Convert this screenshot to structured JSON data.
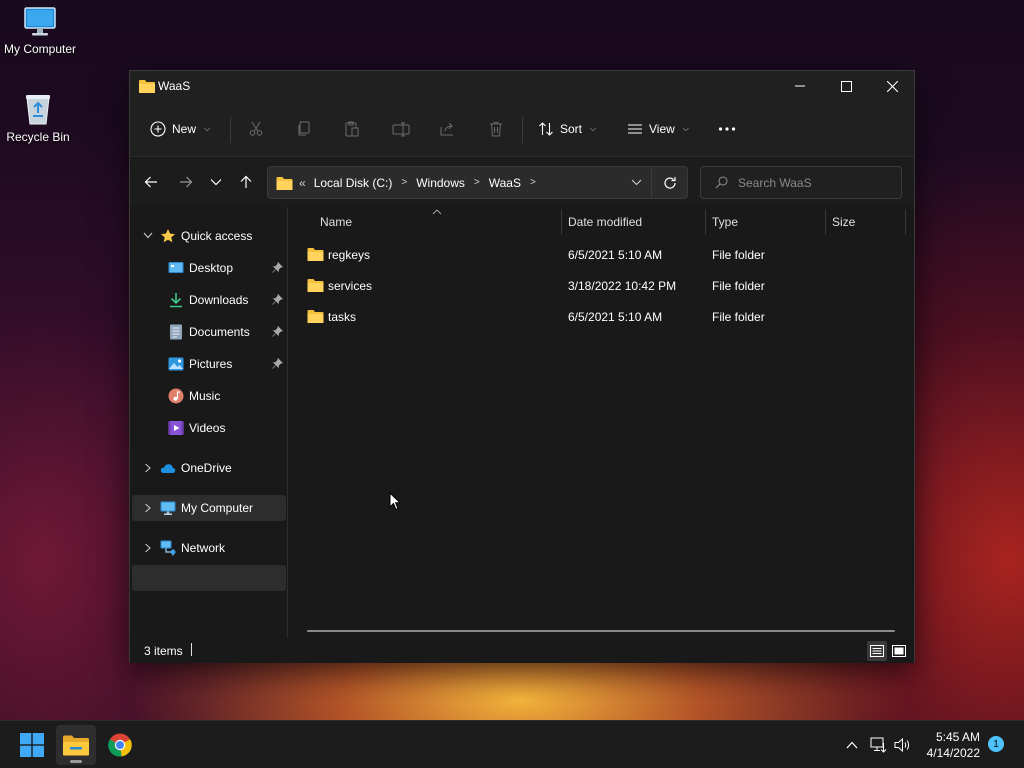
{
  "desktop": {
    "icons": [
      {
        "label": "My Computer",
        "icon": "monitor-icon"
      },
      {
        "label": "Recycle Bin",
        "icon": "recycle-bin-icon"
      }
    ]
  },
  "window": {
    "title": "WaaS",
    "toolbar": {
      "new_label": "New",
      "sort_label": "Sort",
      "view_label": "View"
    },
    "address": {
      "overflow": "«",
      "crumbs": [
        "Local Disk (C:)",
        "Windows",
        "WaaS"
      ]
    },
    "search": {
      "placeholder": "Search WaaS"
    },
    "sidebar": {
      "quick_access": "Quick access",
      "pinned": [
        {
          "label": "Desktop",
          "pinned": true
        },
        {
          "label": "Downloads",
          "pinned": true
        },
        {
          "label": "Documents",
          "pinned": true
        },
        {
          "label": "Pictures",
          "pinned": true
        },
        {
          "label": "Music",
          "pinned": false
        },
        {
          "label": "Videos",
          "pinned": false
        }
      ],
      "onedrive": "OneDrive",
      "my_computer": "My Computer",
      "network": "Network"
    },
    "columns": {
      "name": "Name",
      "date": "Date modified",
      "type": "Type",
      "size": "Size"
    },
    "files": [
      {
        "name": "regkeys",
        "date": "6/5/2021 5:10 AM",
        "type": "File folder",
        "size": ""
      },
      {
        "name": "services",
        "date": "3/18/2022 10:42 PM",
        "type": "File folder",
        "size": ""
      },
      {
        "name": "tasks",
        "date": "6/5/2021 5:10 AM",
        "type": "File folder",
        "size": ""
      }
    ],
    "status": {
      "count": "3 items"
    }
  },
  "taskbar": {
    "time": "5:45 AM",
    "date": "4/14/2022",
    "notifications": "1"
  },
  "colors": {
    "accent": "#4cc2ff",
    "folder": "#f5c03c",
    "window_bg": "#191919"
  }
}
